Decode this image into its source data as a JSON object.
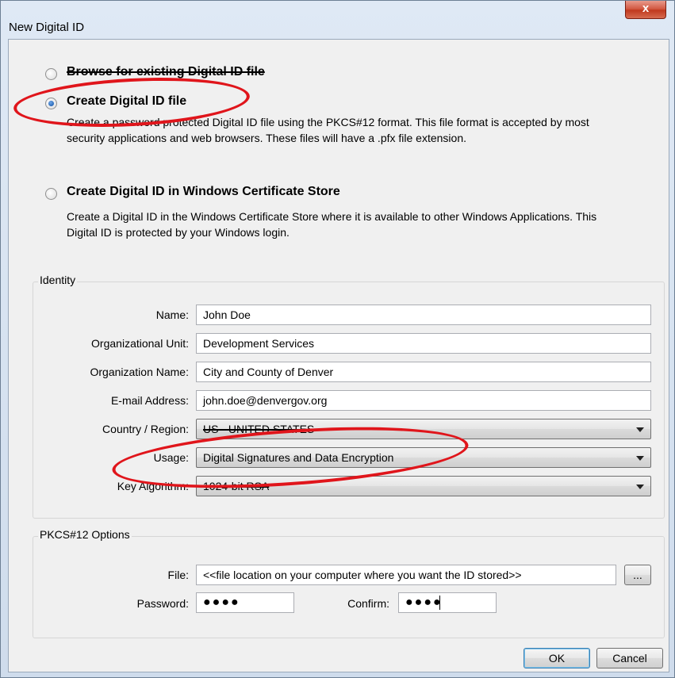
{
  "window": {
    "title": "New Digital ID",
    "close_glyph": "x"
  },
  "options": {
    "browse_label": "Browse for existing Digital ID file",
    "create_file_label": "Create Digital ID file",
    "create_file_desc": "Create a password protected Digital ID file using the PKCS#12 format. This file format is accepted by most security applications and web browsers. These files will have a .pfx file extension.",
    "windows_store_label": "Create Digital ID in Windows Certificate Store",
    "windows_store_desc": "Create a Digital ID in the Windows Certificate Store where it is available to other Windows Applications. This Digital ID is protected by your Windows login.",
    "selected": "create_file"
  },
  "identity": {
    "group_label": "Identity",
    "name_label": "Name:",
    "name_value": "John Doe",
    "org_unit_label": "Organizational Unit:",
    "org_unit_value": "Development Services",
    "org_name_label": "Organization Name:",
    "org_name_value": "City and County of Denver",
    "email_label": "E-mail Address:",
    "email_value": "john.doe@denvergov.org",
    "country_label": "Country / Region:",
    "country_value": "US - UNITED STATES",
    "usage_label": "Usage:",
    "usage_value": "Digital Signatures and Data Encryption",
    "key_label": "Key Algorithm:",
    "key_value": "1024-bit RSA"
  },
  "pkcs": {
    "group_label": "PKCS#12 Options",
    "file_label": "File:",
    "file_value": "<<file location on your computer where you want the ID stored>>",
    "browse_button": "...",
    "password_label": "Password:",
    "password_value": "●●●●",
    "confirm_label": "Confirm:",
    "confirm_value": "●●●●"
  },
  "buttons": {
    "ok": "OK",
    "cancel": "Cancel"
  },
  "annotation": {
    "color": "#e0151b"
  }
}
